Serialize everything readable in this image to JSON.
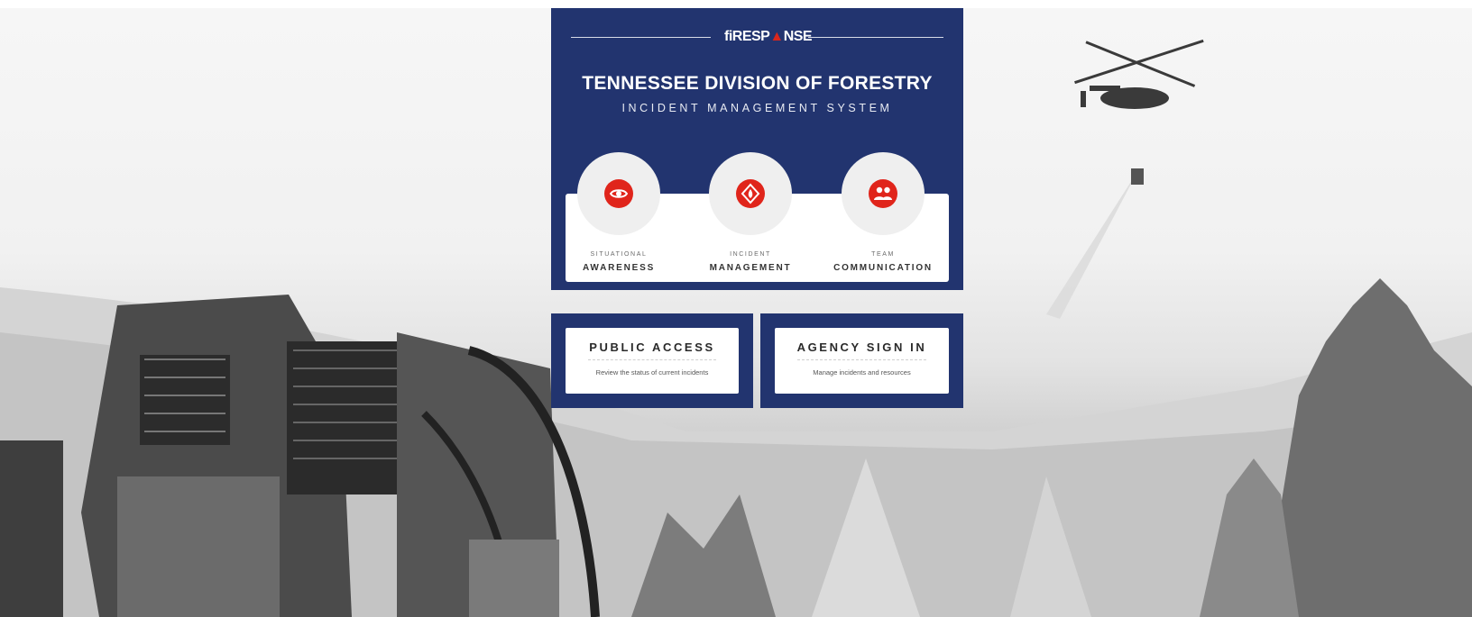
{
  "brand": {
    "logo_prefix": "fiRESP",
    "logo_suffix": "NSE"
  },
  "header": {
    "title": "TENNESSEE DIVISION OF FORESTRY",
    "subtitle": "INCIDENT MANAGEMENT SYSTEM"
  },
  "features": [
    {
      "small": "SITUATIONAL",
      "big": "AWARENESS",
      "icon": "eye-icon"
    },
    {
      "small": "INCIDENT",
      "big": "MANAGEMENT",
      "icon": "flame-icon"
    },
    {
      "small": "TEAM",
      "big": "COMMUNICATION",
      "icon": "people-icon"
    }
  ],
  "access": {
    "public": {
      "title": "PUBLIC ACCESS",
      "desc": "Review the status of current incidents"
    },
    "agency": {
      "title": "AGENCY SIGN IN",
      "desc": "Manage incidents and resources"
    }
  },
  "colors": {
    "navy": "#22346f",
    "accent": "#e0251b"
  }
}
